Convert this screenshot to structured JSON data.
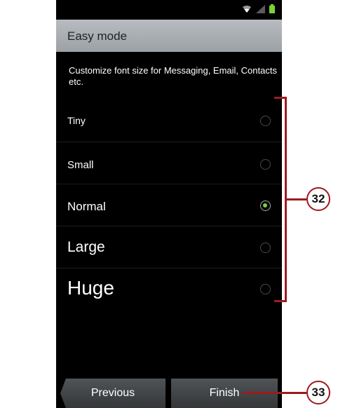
{
  "screen": {
    "title": "Easy mode",
    "description": "Customize font size for Messaging, Email, Contacts etc."
  },
  "status_icons": [
    "wifi-icon",
    "signal-icon",
    "battery-icon"
  ],
  "options": [
    {
      "label": "Tiny",
      "selected": false
    },
    {
      "label": "Small",
      "selected": false
    },
    {
      "label": "Normal",
      "selected": true
    },
    {
      "label": "Large",
      "selected": false
    },
    {
      "label": "Huge",
      "selected": false
    }
  ],
  "buttons": {
    "previous": "Previous",
    "finish": "Finish"
  },
  "callouts": {
    "options_group": "32",
    "finish_button": "33"
  },
  "colors": {
    "accent_selected": "#7ad23a",
    "callout": "#9c1b21",
    "actionbar": "#a9adb1"
  }
}
